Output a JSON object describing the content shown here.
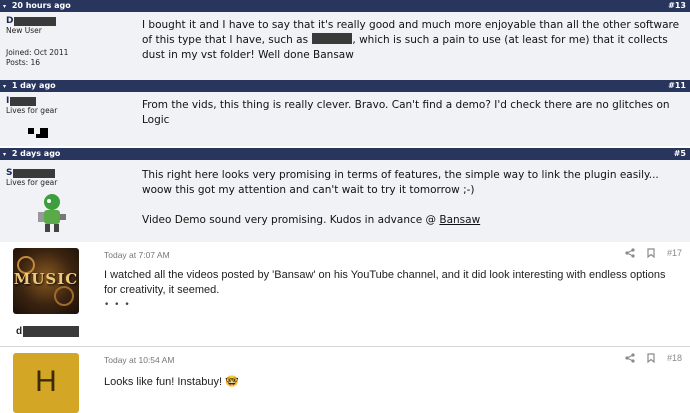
{
  "posts_old": [
    {
      "time": "20 hours ago",
      "number": "#13",
      "username_initial": "D",
      "user_title": "New User",
      "joined": "Joined: Oct 2011",
      "posts": "Posts: 16",
      "body_1": "I bought it and I have to say that it's really good and much more enjoyable than all the other software of this type that I have, such as",
      "body_2": ", which is such a pain to use (at least for me) that it collects dust in my vst folder! Well done Bansaw"
    },
    {
      "time": "1 day ago",
      "number": "#11",
      "username_initial": "I",
      "user_title": "Lives for gear",
      "body": "From the vids, this thing is really clever. Bravo. Can't find a demo? I'd check there are no glitches on Logic"
    },
    {
      "time": "2 days ago",
      "number": "#5",
      "username_initial": "S",
      "user_title": "Lives for gear",
      "body_1": "This right here looks very promising in terms of features, the simple way to link the plugin easily... woow this got my attention and can't wait to try it tomorrow ;-)",
      "body_2": "Video Demo sound very promising. Kudos in advance @ ",
      "mention": "Bansaw"
    }
  ],
  "posts_new": [
    {
      "time": "Today at 7:07 AM",
      "number": "#17",
      "username_initial": "d",
      "avatar_text": "MUSIC",
      "body": "I watched all the videos posted by 'Bansaw' on his YouTube channel, and it did look interesting with endless options for creativity, it seemed.",
      "more": "• • •"
    },
    {
      "time": "Today at 10:54 AM",
      "number": "#18",
      "avatar_letter": "H",
      "body": "Looks like fun! Instabuy! 🤓"
    }
  ],
  "icons": {
    "share": "share-icon",
    "bookmark": "bookmark-icon",
    "arrow": "collapse-arrow-icon"
  },
  "colors": {
    "header_bar": "#28355c",
    "old_post_bg": "#f1f2f5",
    "avatar_h_bg": "#d4a625"
  }
}
